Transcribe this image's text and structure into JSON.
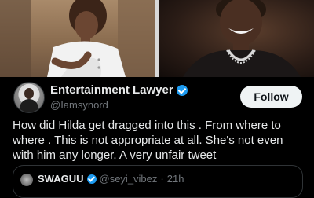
{
  "tweet": {
    "display_name": "Entertainment Lawyer",
    "handle": "@Iamsynord",
    "follow_label": "Follow",
    "text": "How did Hilda get dragged into this . From where to where . This is not appropriate at all. She's not even with him any longer. A very unfair tweet"
  },
  "quoted": {
    "display_name": "SWAGUU",
    "handle": "@seyi_vibez",
    "separator": "·",
    "time": "21h"
  },
  "colors": {
    "verified": "#1d9bf0",
    "background": "#000000",
    "secondary_text": "#71767b"
  },
  "icons": [
    "verified-badge-icon"
  ]
}
